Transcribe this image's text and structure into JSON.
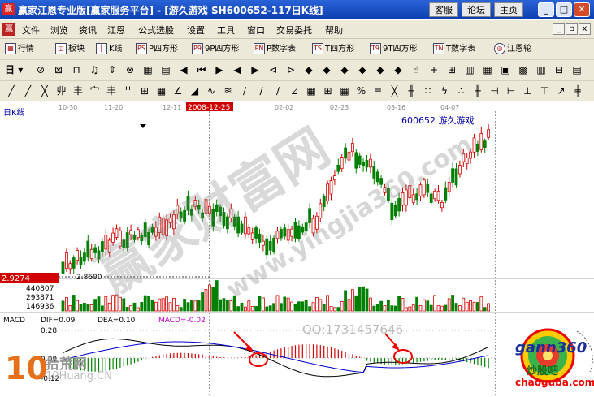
{
  "window": {
    "title": "赢家江恩专业版[赢家服务平台] - [游久游戏   SH600652-117日K线]",
    "buttons": [
      "客服",
      "论坛",
      "主页"
    ]
  },
  "menu": [
    "文件",
    "浏览",
    "资讯",
    "江恩",
    "公式选股",
    "设置",
    "工具",
    "窗口",
    "交易委托",
    "帮助"
  ],
  "toolbar1": [
    "行情",
    "板块",
    "K线",
    "P四方形",
    "9P四方形",
    "P数字表",
    "T四方形",
    "9T四方形",
    "T数字表",
    "江恩轮"
  ],
  "toolbar2": {
    "period": "日"
  },
  "chart": {
    "panel_title": "日K线",
    "stock_label": "600652  游久游戏",
    "date_ticks": [
      "10-30",
      "11-20",
      "12-11",
      "2008-12-25",
      "02-02",
      "02-23",
      "03-16",
      "04-07"
    ],
    "price_marker": "2.9274",
    "low_label": "2.8600",
    "volume_ticks": [
      "440807",
      "293871",
      "146936"
    ],
    "macd_title": "MACD",
    "dif": "DIF=0.09",
    "dea": "DEA=0.10",
    "macd": "MACD=-0.02",
    "macd_ticks": [
      "0.28",
      "0.00",
      "-0.12"
    ],
    "watermark_main": "赢家财富网",
    "watermark_url": "www.yingjia360.com",
    "watermark_qq": "QQ:1731457646",
    "colors": {
      "up": "#d40000",
      "down": "#008000",
      "marker": "#d00000"
    }
  },
  "logos": {
    "left_big": "10",
    "left_site": "拾荒网",
    "left_url": "10Huang.CN",
    "right_brand": "gann360",
    "right_cn": "炒股吧",
    "right_url": "chaoguba.com"
  }
}
